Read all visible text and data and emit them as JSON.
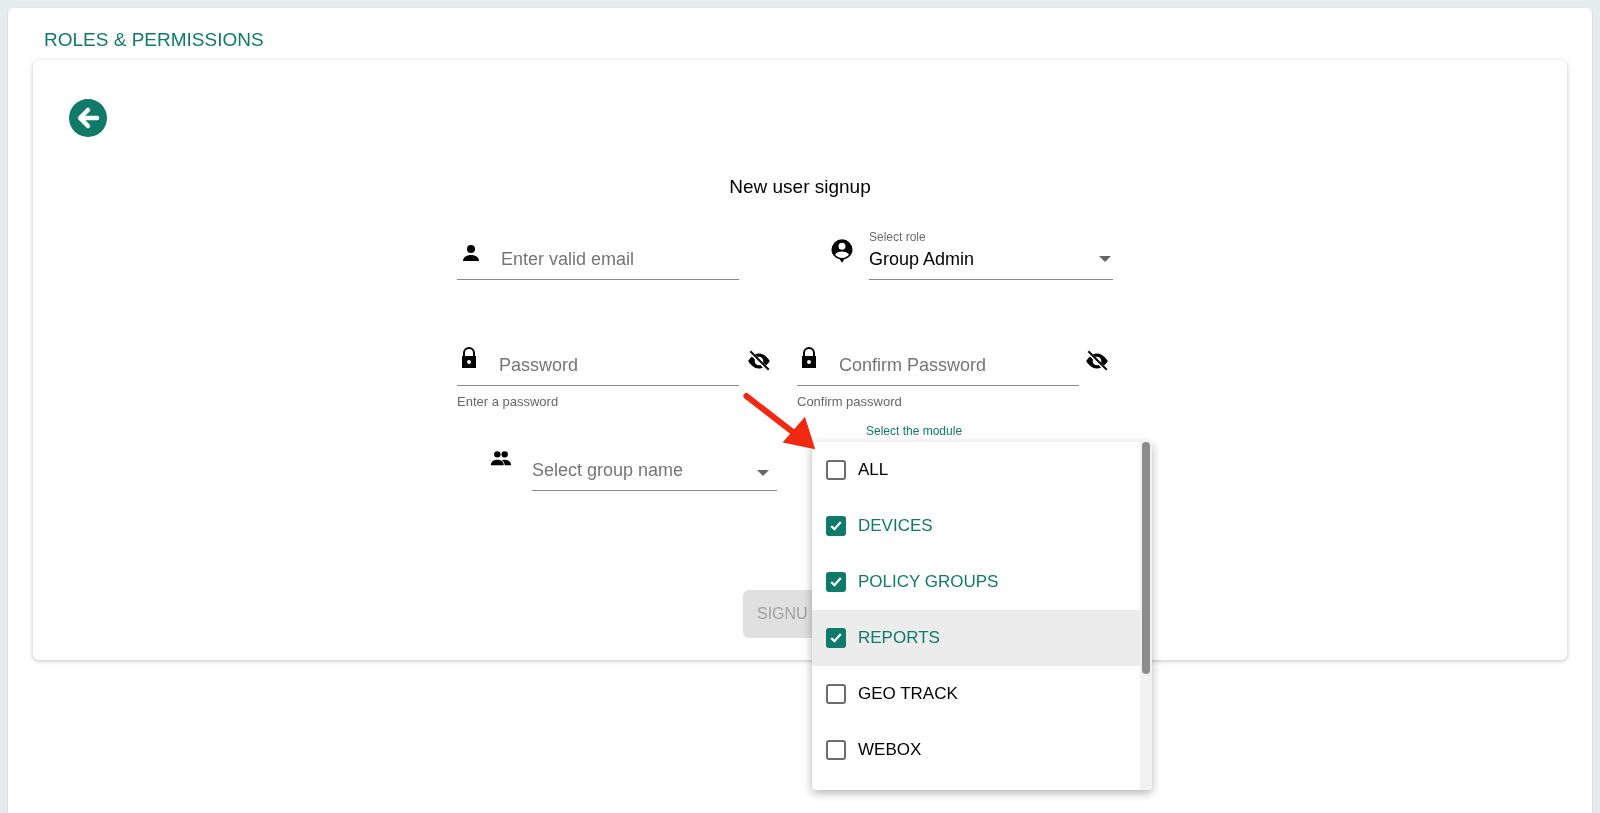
{
  "page_title": "ROLES & PERMISSIONS",
  "form": {
    "heading": "New user signup",
    "email": {
      "placeholder": "Enter valid email"
    },
    "role": {
      "label": "Select role",
      "value": "Group Admin"
    },
    "password": {
      "placeholder": "Password",
      "helper": "Enter a password"
    },
    "confirm_password": {
      "placeholder": "Confirm Password",
      "helper": "Confirm password"
    },
    "group": {
      "placeholder": "Select group name"
    },
    "modules": {
      "label": "Select the module",
      "options": [
        {
          "label": "ALL",
          "checked": false,
          "hovered": false
        },
        {
          "label": "DEVICES",
          "checked": true,
          "hovered": false
        },
        {
          "label": "POLICY GROUPS",
          "checked": true,
          "hovered": false
        },
        {
          "label": "REPORTS",
          "checked": true,
          "hovered": true
        },
        {
          "label": "GEO TRACK",
          "checked": false,
          "hovered": false
        },
        {
          "label": "WEBOX",
          "checked": false,
          "hovered": false
        }
      ]
    },
    "signup_button": {
      "label": "SIGNU",
      "disabled": true
    }
  }
}
